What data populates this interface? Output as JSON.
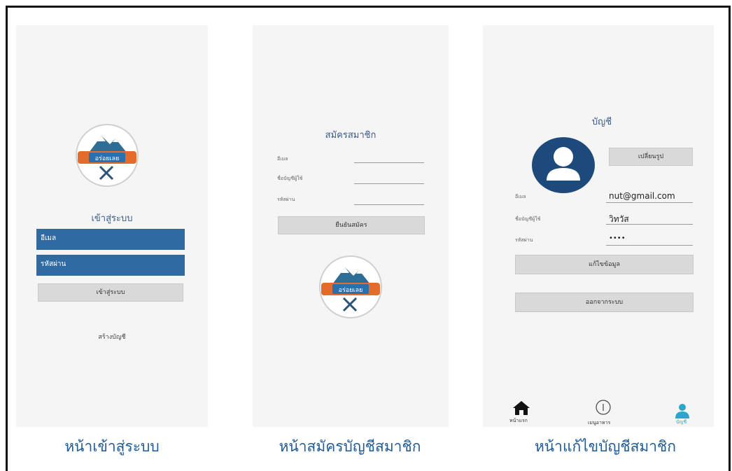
{
  "login_screen": {
    "heading": "เข้าสู่ระบบ",
    "username_placeholder": "อีเมล",
    "password_placeholder": "รหัสผ่าน",
    "login_button": "เข้าสู่ระบบ",
    "create_account_link": "สร้างบัญชี",
    "logo_text": "อร่อยเลย"
  },
  "register_screen": {
    "heading": "สมัครสมาชิก",
    "field_email_label": "อีเมล",
    "field_username_label": "ชื่อบัญชีผู้ใช้",
    "field_password_label": "รหัสผ่าน",
    "register_button": "ยืนยันสมัคร",
    "logo_text": "อร่อยเลย"
  },
  "account_screen": {
    "heading": "บัญชี",
    "change_photo_button": "เปลี่ยนรูป",
    "field_email_label": "อีเมล",
    "field_email_value": "nut@gmail.com",
    "field_username_label": "ชื่อบัญชีผู้ใช้",
    "field_username_value": "วิทวัส",
    "field_password_label": "รหัสผ่าน",
    "field_password_value": "••••",
    "edit_button": "แก้ไขข้อมูล",
    "logout_button": "ออกจากระบบ",
    "nav": {
      "home_label": "หน้าแรก",
      "menu_label": "เมนูอาหาร",
      "account_label": "บัญชี"
    }
  },
  "captions": {
    "login": "หน้าเข้าสู่ระบบ",
    "register": "หน้าสมัครบัญชีสมาชิก",
    "edit_account": "หน้าแก้ไขบัญชีสมาชิก"
  },
  "colors": {
    "primary_blue": "#2f6aa0",
    "caption_blue": "#1e5a96",
    "nav_active": "#2aa7c9",
    "avatar_bg": "#1d4a7a",
    "logo_orange": "#e46b2a"
  },
  "icons": {
    "home": "home-icon",
    "menu": "info-circle-icon",
    "account": "user-icon",
    "avatar": "user-avatar-icon"
  }
}
